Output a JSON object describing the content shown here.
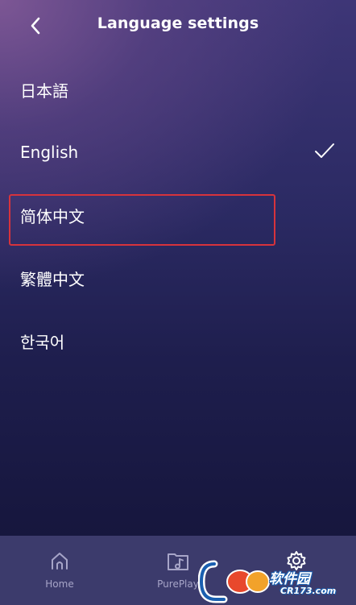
{
  "header": {
    "title": "Language settings",
    "back_icon": "chevron-left-icon"
  },
  "languages": [
    {
      "label": "日本語",
      "selected": false
    },
    {
      "label": "English",
      "selected": true
    },
    {
      "label": "简体中文",
      "selected": false,
      "highlighted": true
    },
    {
      "label": "繁體中文",
      "selected": false
    },
    {
      "label": "한국어",
      "selected": false
    }
  ],
  "check_icon": "check-icon",
  "highlight_color": "#d7333c",
  "bottom_nav": {
    "items": [
      {
        "label": "Home",
        "icon": "home-icon"
      },
      {
        "label": "PurePlay",
        "icon": "music-folder-icon"
      },
      {
        "label": "",
        "icon": "gear-icon"
      }
    ]
  },
  "watermark": {
    "logo_text": "软件园",
    "sub_text": "CR173.com"
  },
  "colors": {
    "background_top": "#3e3677",
    "background_bottom": "#15163b",
    "nav_background": "#3c3b6c",
    "nav_label": "#a7a5c8"
  }
}
